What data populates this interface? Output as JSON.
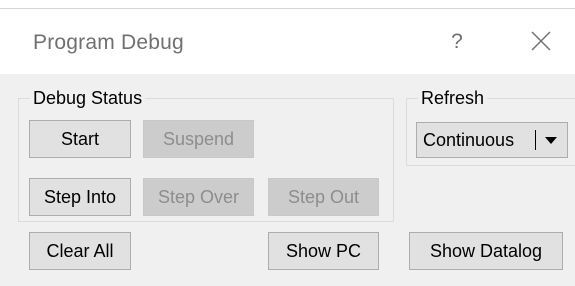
{
  "window": {
    "title": "Program Debug",
    "help_label": "?"
  },
  "debug_status": {
    "label": "Debug Status",
    "start_label": "Start",
    "suspend_label": "Suspend",
    "step_into_label": "Step Into",
    "step_over_label": "Step Over",
    "step_out_label": "Step Out"
  },
  "refresh": {
    "label": "Refresh",
    "selected": "Continuous"
  },
  "bottom": {
    "clear_all_label": "Clear All",
    "show_pc_label": "Show PC",
    "show_datalog_label": "Show Datalog"
  },
  "icons": {
    "close": "close-icon",
    "dropdown": "chevron-down-icon"
  },
  "colors": {
    "dialog_bg": "#f0f0f0",
    "button_bg": "#e1e1e1",
    "button_border": "#adadad",
    "disabled_bg": "#cccccc",
    "disabled_text": "#8d8d8d",
    "title_text": "#707070"
  }
}
